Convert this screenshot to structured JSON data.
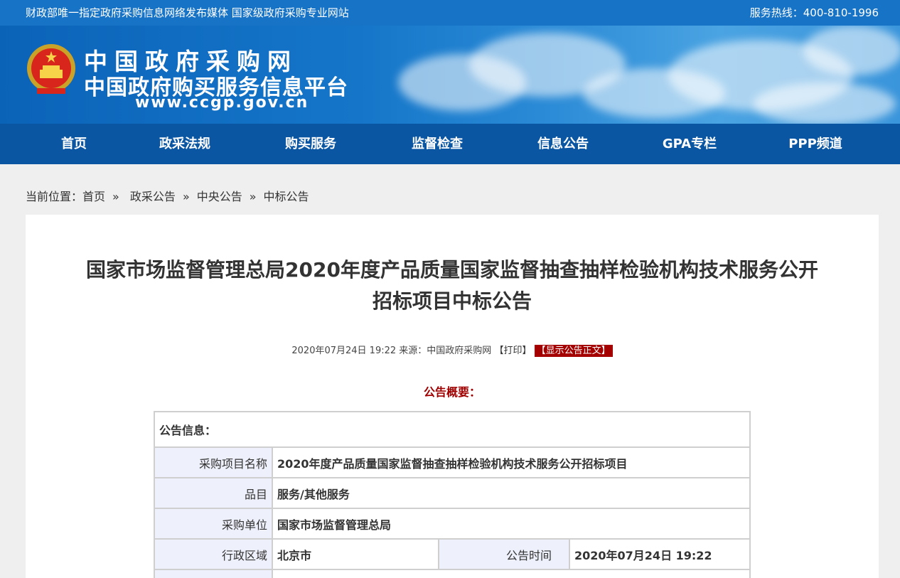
{
  "topbar": {
    "left_text": "财政部唯一指定政府采购信息网络发布媒体  国家级政府采购专业网站",
    "hotline": "服务热线：400-810-1996"
  },
  "banner": {
    "logo_line1": "中国政府采购网",
    "logo_line2": "中国政府购买服务信息平台",
    "logo_url": "www.ccgp.gov.cn"
  },
  "nav": {
    "items": [
      "首页",
      "政采法规",
      "购买服务",
      "监督检查",
      "信息公告",
      "GPA专栏",
      "PPP频道"
    ]
  },
  "breadcrumb": {
    "prefix": "当前位置：",
    "items": [
      "首页",
      "政采公告",
      "中央公告",
      "中标公告"
    ],
    "separator": "»"
  },
  "article": {
    "title_line1": "国家市场监督管理总局2020年度产品质量国家监督抽查抽样检验机构技术服务公开",
    "title_line2": "招标项目中标公告",
    "date": "2020年07月24日 19:22",
    "source_label": "来源：",
    "source": "中国政府采购网",
    "print_label": "【打印】",
    "show_label": "【显示公告正文】",
    "summary_heading": "公告概要："
  },
  "info_table": {
    "heading": "公告信息：",
    "rows": [
      {
        "key": "采购项目名称",
        "value": "2020年度产品质量国家监督抽查抽样检验机构技术服务公开招标项目"
      },
      {
        "key": "品目",
        "value": "服务/其他服务"
      },
      {
        "key": "采购单位",
        "value": "国家市场监督管理总局"
      }
    ],
    "region_key": "行政区域",
    "region_value": "北京市",
    "time_key": "公告时间",
    "time_value": "2020年07月24日  19:22"
  },
  "colors": {
    "topbar": "#1773c6",
    "nav": "#0a56a3",
    "accent_red": "#a40000",
    "table_key_bg": "#eef0fb"
  }
}
